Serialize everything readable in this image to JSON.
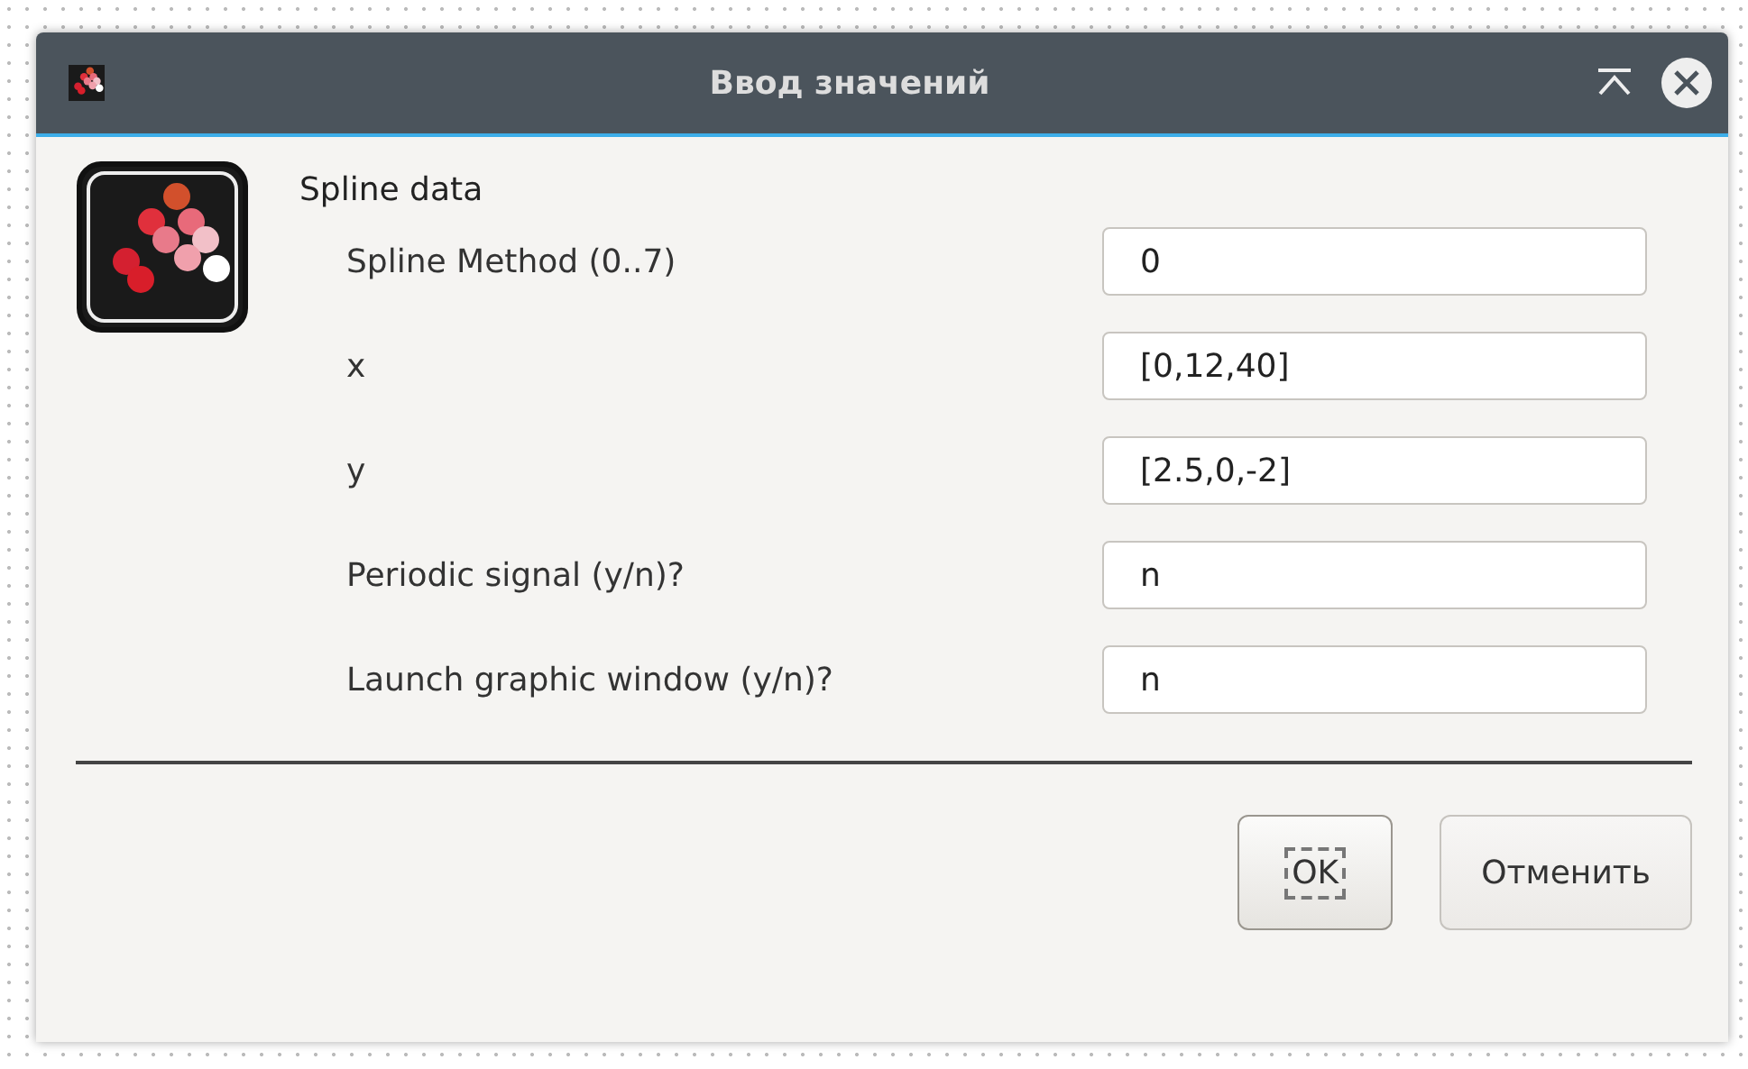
{
  "window": {
    "title": "Ввод значений"
  },
  "heading": "Spline data",
  "fields": [
    {
      "label": "Spline Method (0..7)",
      "value": "0"
    },
    {
      "label": "x",
      "value": "[0,12,40]"
    },
    {
      "label": "y",
      "value": "[2.5,0,-2]"
    },
    {
      "label": "Periodic signal (y/n)?",
      "value": "n"
    },
    {
      "label": "Launch graphic window (y/n)?",
      "value": "n"
    }
  ],
  "buttons": [
    {
      "label": "OK",
      "focused": true
    },
    {
      "label": "Отменить",
      "focused": false
    }
  ]
}
